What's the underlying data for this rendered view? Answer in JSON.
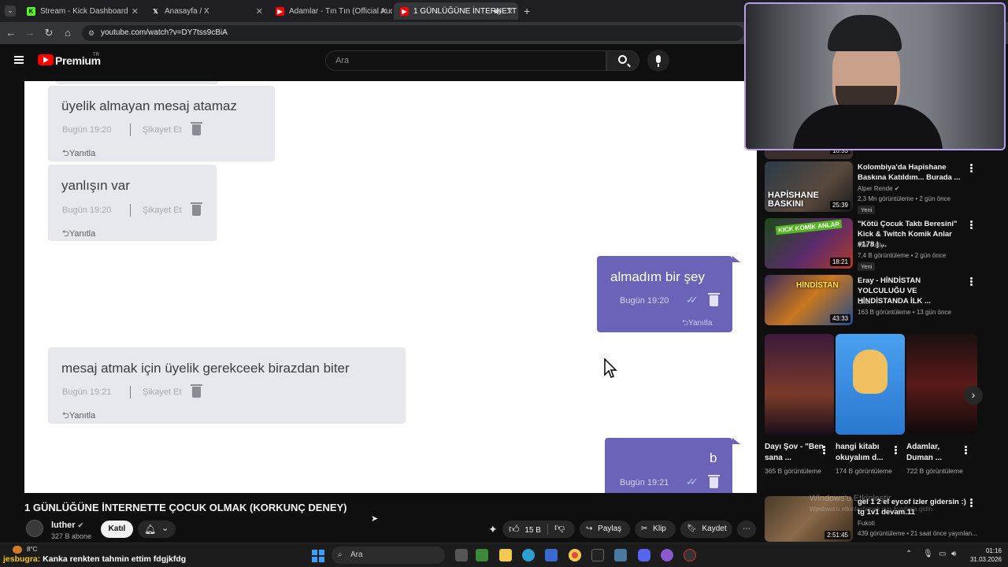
{
  "browser": {
    "tabs": [
      {
        "label": "Stream - Kick Dashboard",
        "icon": "kick-icon"
      },
      {
        "label": "Anasayfa / X",
        "icon": "x-icon"
      },
      {
        "label": "Adamlar - Tın Tın (Official Audi",
        "icon": "youtube-icon"
      },
      {
        "label": "1 GÜNLÜĞÜNE İNTERNETT",
        "icon": "youtube-icon"
      }
    ],
    "url": "youtube.com/watch?v=DY7tss9cBiA"
  },
  "header": {
    "logo_text": "Premium",
    "region": "TR",
    "search_placeholder": "Ara"
  },
  "video": {
    "incoming": [
      {
        "text": "üyelik almayan mesaj atamaz",
        "time": "Bugün 19:20",
        "report": "Şikayet Et",
        "reply": "Yanıtla"
      },
      {
        "text": "yanlışın var",
        "time": "Bugün 19:20",
        "report": "Şikayet Et",
        "reply": "Yanıtla"
      },
      {
        "text": "mesaj atmak için üyelik gerekceek birazdan biter",
        "time": "Bugün 19:21",
        "report": "Şikayet Et",
        "reply": "Yanıtla"
      }
    ],
    "outgoing": [
      {
        "text": "almadım bir şey",
        "time": "Bugün 19:20",
        "reply": "Yanıtla"
      },
      {
        "text": "b",
        "time": "Bugün 19:21"
      }
    ]
  },
  "watch": {
    "title": "1 GÜNLÜĞÜNE İNTERNETTE ÇOCUK OLMAK (KORKUNÇ DENEY)",
    "channel": "luther",
    "subscribers": "327 B abone",
    "join_label": "Katıl",
    "like_count": "15 B",
    "share_label": "Paylaş",
    "clip_label": "Klip",
    "save_label": "Kaydet"
  },
  "sidebar": {
    "top_duration": "10:53",
    "recommendations": [
      {
        "title": "Kolombiya'da Hapishane Baskına Katıldım... Burada ...",
        "channel": "Alper Rende",
        "stats": "2,3 Mn görüntüleme • 2 gün önce",
        "badge": "Yeni",
        "duration": "25:39",
        "thumb_text": "HAPİSHANE BASKINI"
      },
      {
        "title": "\"Kötü Çocuk Taktı Beresini\" Kick & Twitch Komik Anlar #178 | ...",
        "channel": "The Pally",
        "stats": "7,4 B görüntüleme • 2 gün önce",
        "badge": "Yeni",
        "duration": "18:21",
        "thumb_text": "KICK KOMİK ANLAR"
      },
      {
        "title": "Eray - HİNDİSTAN YOLCULUĞU VE HİNDİSTANDA İLK ...",
        "channel": "Cilet",
        "stats": "163 B görüntüleme • 13 gün önce",
        "badge": "",
        "duration": "43:33",
        "thumb_text": "HİNDİSTAN"
      }
    ],
    "shorts": [
      {
        "title": "Dayı Şov - \"Ben sana ...",
        "views": "365 B görüntüleme"
      },
      {
        "title": "hangi kitabı okuyalım d...",
        "views": "174 B görüntüleme"
      },
      {
        "title": "Adamlar, Duman ...",
        "views": "722 B görüntüleme"
      }
    ],
    "bottom": {
      "title": "gel 1 2 el eycof izler gidersin :) tg 1v1 devam.11",
      "channel": "Fukoti",
      "stats": "439 görüntüleme • 21 saat önce yayınlan...",
      "duration": "2:51:45",
      "watermark": "Windows'u Etkinleştir",
      "watermark2": "Windows'u etkinleştirmek için Ayarlar'a gidin."
    }
  },
  "taskbar": {
    "weather": "8°C",
    "marquee_user": "jesbugra:",
    "marquee_text": " Kanka renkten tahmin ettim fdgjkfdg",
    "search_placeholder": "Ara",
    "time": "01:16",
    "date": "31.03.2026"
  }
}
